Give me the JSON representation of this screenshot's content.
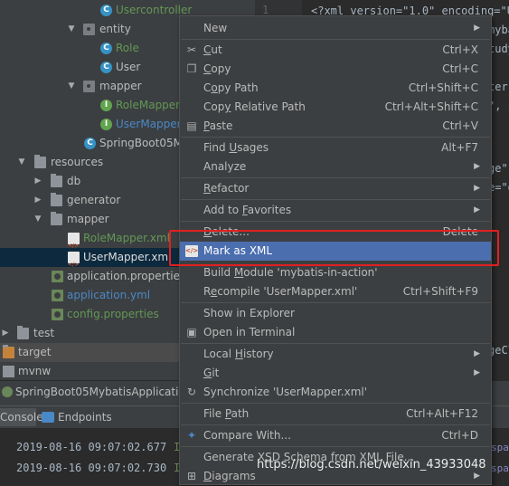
{
  "project_tree": {
    "items": [
      {
        "label": "Usercontroller",
        "type": "class-c",
        "color": "green"
      },
      {
        "label": "entity",
        "type": "package",
        "color": "default"
      },
      {
        "label": "Role",
        "type": "class-c",
        "color": "green"
      },
      {
        "label": "User",
        "type": "class-c",
        "color": "default"
      },
      {
        "label": "mapper",
        "type": "package",
        "color": "default"
      },
      {
        "label": "RoleMapper",
        "type": "class-i",
        "color": "green"
      },
      {
        "label": "UserMapper",
        "type": "class-i",
        "color": "blue"
      },
      {
        "label": "SpringBoot05M",
        "type": "class-c",
        "color": "default"
      },
      {
        "label": "resources",
        "type": "folder",
        "color": "default"
      },
      {
        "label": "db",
        "type": "folder",
        "color": "default"
      },
      {
        "label": "generator",
        "type": "folder",
        "color": "default"
      },
      {
        "label": "mapper",
        "type": "folder",
        "color": "default"
      },
      {
        "label": "RoleMapper.xml",
        "type": "xml",
        "color": "green"
      },
      {
        "label": "UserMapper.xml",
        "type": "xml",
        "color": "selected"
      },
      {
        "label": "application.properties",
        "type": "prop",
        "color": "default"
      },
      {
        "label": "application.yml",
        "type": "prop",
        "color": "link"
      },
      {
        "label": "config.properties",
        "type": "prop",
        "color": "green"
      },
      {
        "label": "test",
        "type": "folder",
        "color": "default"
      },
      {
        "label": "target",
        "type": "folder",
        "color": "default"
      },
      {
        "label": "mvnw",
        "type": "file",
        "color": "default"
      }
    ]
  },
  "editor": {
    "line_number": "1",
    "lines": [
      "<?xml version=\"1.0\" encoding=\"U",
      "mybat",
      "tudyj",
      "",
      "ter\"",
      "\", s",
      "",
      "",
      "ge\"",
      "e=\"d"
    ],
    "bottom_fragment": "geCl"
  },
  "run_panel": {
    "title": "SpringBoot05MybatisApplicatio",
    "tabs": [
      {
        "label": "Console"
      },
      {
        "label": "Endpoints"
      }
    ],
    "log_lines": [
      {
        "text": "2019-08-16 09:07:02.677",
        "level": "I",
        "tail": "spa"
      },
      {
        "text": "2019-08-16 09:07:02.730",
        "level": "I",
        "tail": "spa"
      }
    ]
  },
  "context_menu": {
    "items": [
      {
        "label": "New",
        "shortcut": "",
        "submenu": true,
        "icon": ""
      },
      {
        "sep": true
      },
      {
        "label": "Cut",
        "shortcut": "Ctrl+X",
        "icon": "scissors-icon",
        "glyph": "✂"
      },
      {
        "label": "Copy",
        "shortcut": "Ctrl+C",
        "icon": "copy-icon",
        "glyph": "❐"
      },
      {
        "label": "Copy Path",
        "shortcut": "Ctrl+Shift+C"
      },
      {
        "label": "Copy Relative Path",
        "shortcut": "Ctrl+Alt+Shift+C"
      },
      {
        "label": "Paste",
        "shortcut": "Ctrl+V",
        "icon": "paste-icon",
        "glyph": "▤"
      },
      {
        "sep": true
      },
      {
        "label": "Find Usages",
        "shortcut": "Alt+F7"
      },
      {
        "label": "Analyze",
        "submenu": true
      },
      {
        "sep": true
      },
      {
        "label": "Refactor",
        "submenu": true
      },
      {
        "sep": true
      },
      {
        "label": "Add to Favorites",
        "submenu": true
      },
      {
        "sep": true
      },
      {
        "label": "Delete...",
        "shortcut": "Delete"
      },
      {
        "label": "Mark as XML",
        "shortcut": "",
        "icon": "xml-file-icon",
        "glyph": "</>",
        "active": true
      },
      {
        "label": "Build Module 'mybatis-in-action'"
      },
      {
        "label": "Recompile 'UserMapper.xml'",
        "shortcut": "Ctrl+Shift+F9"
      },
      {
        "sep": true
      },
      {
        "label": "Show in Explorer"
      },
      {
        "label": "Open in Terminal",
        "icon": "terminal-icon",
        "glyph": "▣"
      },
      {
        "sep": true
      },
      {
        "label": "Local History",
        "submenu": true
      },
      {
        "label": "Git",
        "submenu": true
      },
      {
        "label": "Synchronize 'UserMapper.xml'",
        "icon": "sync-icon",
        "glyph": "↻"
      },
      {
        "sep": true
      },
      {
        "label": "File Path",
        "shortcut": "Ctrl+Alt+F12"
      },
      {
        "sep": true
      },
      {
        "label": "Compare With...",
        "shortcut": "Ctrl+D",
        "icon": "compare-icon",
        "glyph": "✦"
      },
      {
        "sep": true
      },
      {
        "label": "Generate XSD Schema from XML File..."
      },
      {
        "label": "Diagrams",
        "submenu": true,
        "icon": "diagram-icon",
        "glyph": "⊞"
      }
    ]
  },
  "watermark": "https://blog.csdn.net/weixin_43933048",
  "colors": {
    "menu_bg": "#3c3f41",
    "menu_highlight": "#4b6eaf",
    "annotation_box": "#e02020",
    "selection": "#0d293e"
  }
}
